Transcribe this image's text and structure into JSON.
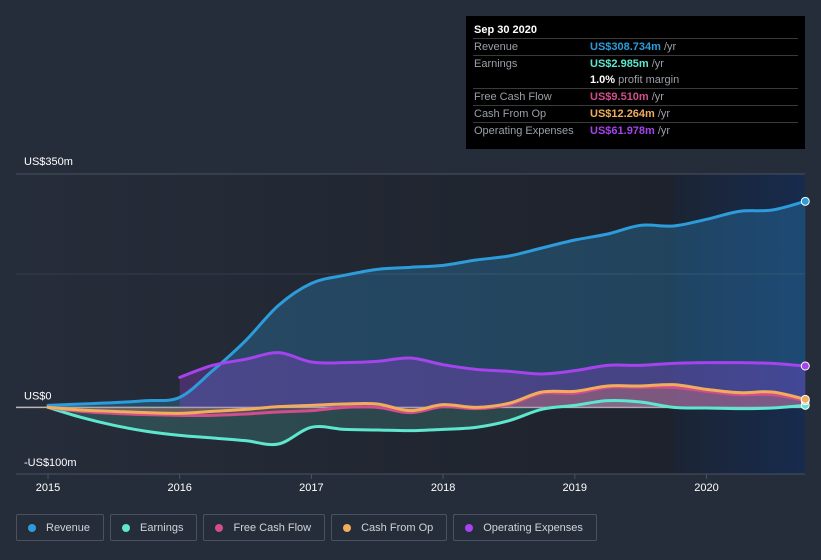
{
  "tooltip": {
    "date": "Sep 30 2020",
    "rows": [
      {
        "label": "Revenue",
        "value": "US$308.734m",
        "unit": "/yr",
        "color": "#2d9cdb"
      },
      {
        "label": "Earnings",
        "value": "US$2.985m",
        "unit": "/yr",
        "color": "#5ee6cf"
      },
      {
        "label": "",
        "value": "1.0%",
        "unit": "profit margin",
        "color": "#ffffff"
      },
      {
        "label": "Free Cash Flow",
        "value": "US$9.510m",
        "unit": "/yr",
        "color": "#d04e8c"
      },
      {
        "label": "Cash From Op",
        "value": "US$12.264m",
        "unit": "/yr",
        "color": "#f0ad5c"
      },
      {
        "label": "Operating Expenses",
        "value": "US$61.978m",
        "unit": "/yr",
        "color": "#a543ed"
      }
    ]
  },
  "legend": [
    {
      "label": "Revenue",
      "color": "#2d9cdb"
    },
    {
      "label": "Earnings",
      "color": "#5ee6cf"
    },
    {
      "label": "Free Cash Flow",
      "color": "#d04e8c"
    },
    {
      "label": "Cash From Op",
      "color": "#f0ad5c"
    },
    {
      "label": "Operating Expenses",
      "color": "#a543ed"
    }
  ],
  "chart_data": {
    "type": "line",
    "title": "",
    "xlabel": "",
    "ylabel": "",
    "y_tick_labels": [
      "US$350m",
      "US$0",
      "-US$100m"
    ],
    "y_ticks": [
      350,
      0,
      -100
    ],
    "ylim": [
      -100,
      350
    ],
    "xlim": [
      2014.75,
      2020.75
    ],
    "x_ticks": [
      2015,
      2016,
      2017,
      2018,
      2019,
      2020
    ],
    "x_tick_labels": [
      "2015",
      "2016",
      "2017",
      "2018",
      "2019",
      "2020"
    ],
    "grid": true,
    "highlight_region": [
      2019.75,
      2020.75
    ],
    "legend_position": "bottom",
    "x": [
      2015.0,
      2015.25,
      2015.5,
      2015.75,
      2016.0,
      2016.25,
      2016.5,
      2016.75,
      2017.0,
      2017.25,
      2017.5,
      2017.75,
      2018.0,
      2018.25,
      2018.5,
      2018.75,
      2019.0,
      2019.25,
      2019.5,
      2019.75,
      2020.0,
      2020.25,
      2020.5,
      2020.75
    ],
    "series": [
      {
        "name": "Revenue",
        "color": "#2d9cdb",
        "values": [
          3,
          5,
          7,
          10,
          15,
          55,
          100,
          153,
          186,
          198,
          207,
          210,
          213,
          221,
          227,
          239,
          251,
          260,
          273,
          272,
          282,
          294,
          296,
          309
        ]
      },
      {
        "name": "Earnings",
        "color": "#5ee6cf",
        "values": [
          0,
          -15,
          -27,
          -36,
          -42,
          -46,
          -50,
          -55,
          -30,
          -33,
          -34,
          -35,
          -33,
          -30,
          -20,
          -3,
          3,
          10,
          8,
          0,
          -1,
          -2,
          -1,
          3
        ]
      },
      {
        "name": "Free Cash Flow",
        "color": "#d04e8c",
        "values": [
          0,
          -6,
          -9,
          -11,
          -12,
          -12,
          -10,
          -7,
          -5,
          0,
          0,
          -8,
          1,
          -2,
          4,
          21,
          21,
          30,
          30,
          30,
          24,
          19,
          19,
          10
        ]
      },
      {
        "name": "Cash From Op",
        "color": "#f0ad5c",
        "values": [
          0,
          -4,
          -6,
          -8,
          -9,
          -6,
          -3,
          1,
          3,
          5,
          5,
          -5,
          4,
          0,
          6,
          23,
          24,
          32,
          32,
          34,
          27,
          22,
          23,
          12
        ]
      },
      {
        "name": "Operating Expenses",
        "color": "#a543ed",
        "values": [
          null,
          null,
          null,
          null,
          45,
          63,
          72,
          82,
          68,
          67,
          69,
          74,
          64,
          57,
          54,
          50,
          55,
          63,
          63,
          66,
          67,
          67,
          66,
          62
        ]
      }
    ]
  }
}
